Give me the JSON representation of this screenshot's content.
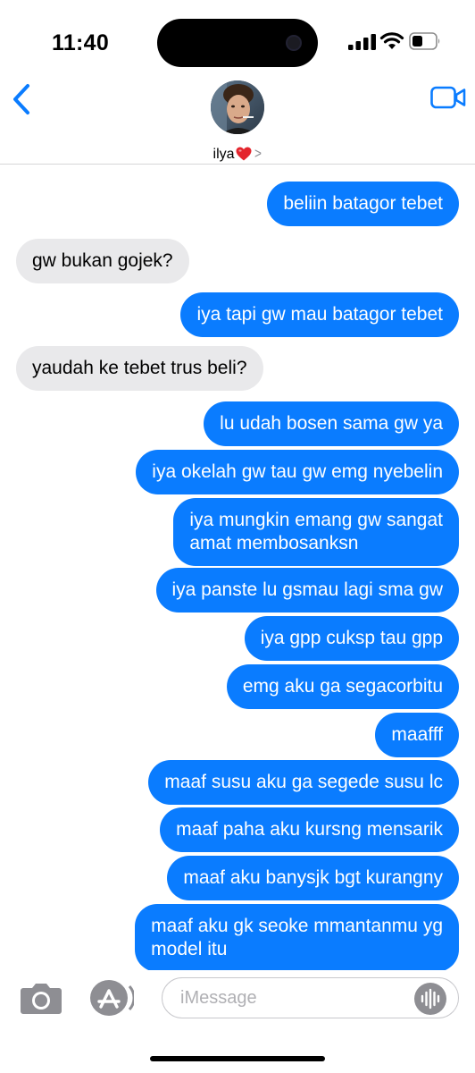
{
  "status_bar": {
    "time": "11:40",
    "icons": [
      "signal-icon",
      "wifi-icon",
      "battery-icon"
    ]
  },
  "header": {
    "back_icon": "chevron-left-icon",
    "video_icon": "video-camera-icon",
    "contact_name": "ilya",
    "contact_emoji": "red-heart-icon",
    "detail_icon": "chevron-right-icon"
  },
  "messages": [
    {
      "from": "me",
      "text": "beliin batagor tebet"
    },
    {
      "from": "them",
      "text": "gw bukan gojek?"
    },
    {
      "from": "me",
      "text": "iya tapi gw mau batagor tebet"
    },
    {
      "from": "them",
      "text": "yaudah ke tebet trus beli?"
    },
    {
      "from": "me",
      "text": "lu udah bosen sama gw ya"
    },
    {
      "from": "me",
      "text": "iya okelah gw tau gw emg nyebelin"
    },
    {
      "from": "me",
      "lines": [
        "iya mungkin emang gw sangat",
        "amat membosanksn"
      ]
    },
    {
      "from": "me",
      "text": "iya panste lu gsmau lagi sma gw"
    },
    {
      "from": "me",
      "text": "iya gpp cuksp tau gpp"
    },
    {
      "from": "me",
      "text": "emg aku ga segacorbitu"
    },
    {
      "from": "me",
      "text": "maafff"
    },
    {
      "from": "me",
      "text": "maaf susu aku ga segede susu lc"
    },
    {
      "from": "me",
      "text": "maaf paha aku kursng mensarik"
    },
    {
      "from": "me",
      "text": "maaf aku banysjk bgt kurangny"
    },
    {
      "from": "me",
      "lines": [
        "maaf aku gk seoke mmantanmu yg",
        "model itu"
      ]
    }
  ],
  "input_bar": {
    "placeholder": "iMessage",
    "camera_icon": "camera-icon",
    "apps_icon": "app-store-icon",
    "audio_icon": "audio-waveform-icon"
  },
  "colors": {
    "outgoing_bubble": "#0a7cff",
    "incoming_bubble": "#e9e9eb",
    "accent": "#0a7cff"
  }
}
